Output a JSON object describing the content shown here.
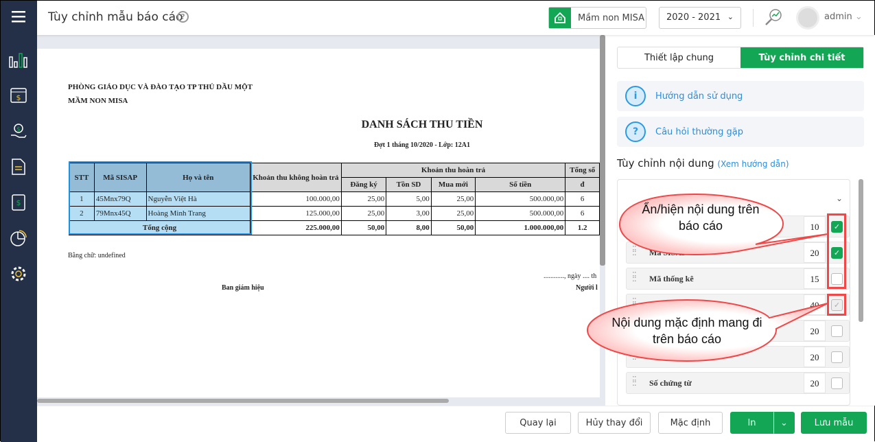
{
  "header": {
    "title": "Tùy chỉnh mẫu báo cáo",
    "help": "?",
    "school": "Mầm non MISA",
    "year": "2020 - 2021",
    "user": "admin"
  },
  "report": {
    "org1": "PHÒNG GIÁO DỤC VÀ ĐÀO TẠO TP THỦ DẦU MỘT",
    "org2": "MẦM NON MISA",
    "title": "DANH SÁCH THU TIỀN",
    "subtitle": "Đợt 1 tháng 10/2020 - Lớp: 12A1",
    "headers": {
      "stt": "STT",
      "ma": "Mã SISAP",
      "ten": "Họ và tên",
      "khong": "Khoản thu không hoàn trả",
      "hoan": "Khoản thu hoàn trả",
      "dk": "Đăng ký",
      "ton": "Tồn SD",
      "mua": "Mua mới",
      "tien": "Số tiền",
      "tong": "Tổng số",
      "tong2": "đ"
    },
    "rows": [
      {
        "stt": "1",
        "ma": "45Mnx79Q",
        "ten": "Nguyễn Việt Hà",
        "khong": "100.000,00",
        "dk": "25,00",
        "ton": "5,00",
        "mua": "25,00",
        "tien": "500.000,00",
        "tong": "6"
      },
      {
        "stt": "2",
        "ma": "79Mnx45Q",
        "ten": "Hoàng Minh Trang",
        "khong": "125.000,00",
        "dk": "25,00",
        "ton": "3,00",
        "mua": "25,00",
        "tien": "500.000,00",
        "tong": "6"
      }
    ],
    "total": {
      "label": "Tổng cộng",
      "khong": "225.000,00",
      "dk": "50,00",
      "ton": "8,00",
      "mua": "50,00",
      "tien": "1.000.000,00",
      "tong": "1.2"
    },
    "words": "Bằng chữ: undefined",
    "date": "............, ngày .... th",
    "sign1": "Ban giám hiệu",
    "sign2": "Người l"
  },
  "panel": {
    "tab1": "Thiết lập chung",
    "tab2": "Tùy chỉnh chi tiết",
    "guide": "Hướng dẫn sử dụng",
    "faq": "Câu hỏi thường gặp",
    "section": "Tùy chỉnh nội dung",
    "section_link": "(Xem hướng dẫn)",
    "items": [
      {
        "label": "",
        "width": "10",
        "state": "on"
      },
      {
        "label": "Mã SISAP",
        "width": "20",
        "state": "on"
      },
      {
        "label": "Mã thống kê",
        "width": "15",
        "state": "off"
      },
      {
        "label": "",
        "width": "40",
        "state": "dis"
      },
      {
        "label": "",
        "width": "20",
        "state": "off"
      },
      {
        "label": "",
        "width": "20",
        "state": "off"
      },
      {
        "label": "Số chứng từ",
        "width": "20",
        "state": "off"
      }
    ]
  },
  "callouts": {
    "c1": "Ẩn/hiện nội dung trên báo cáo",
    "c2": "Nội dung mặc định mang đi trên báo cáo"
  },
  "footer": {
    "back": "Quay lại",
    "undo": "Hủy thay đổi",
    "default": "Mặc định",
    "print": "In",
    "save": "Lưu mẫu"
  },
  "colors": {
    "green": "#13a655",
    "sidebar": "#233047",
    "blue": "#2a8ee0",
    "red": "#f04848"
  }
}
